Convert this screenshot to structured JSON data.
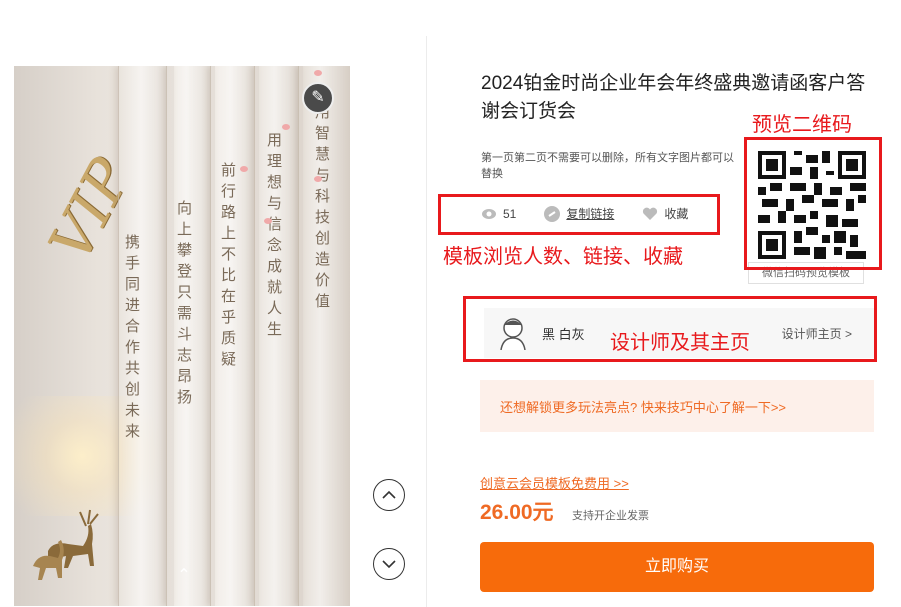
{
  "preview": {
    "vip_text": "VIP",
    "columns": [
      "携手同进合作共创未来",
      "向上攀登只需斗志昂扬",
      "前行路上不比在乎质疑",
      "用理想与信念成就人生",
      "用智慧与科技创造价值"
    ]
  },
  "product": {
    "title": "2024铂金时尚企业年会年终盛典邀请函客户答谢会订货会",
    "description": "第一页第二页不需要可以删除，所有文字图片都可以替换",
    "views": "51",
    "copy_link_label": "复制链接",
    "favorite_label": "收藏",
    "qr_caption": "微信扫码预览模板"
  },
  "designer": {
    "name": "黑 白灰",
    "homepage_label": "设计师主页 >"
  },
  "tip_text": "还想解锁更多玩法亮点? 快来技巧中心了解一下>>",
  "vip_offer": "创意云会员模板免费用 >>",
  "price": "26.00元",
  "invoice_note": "支持开企业发票",
  "buy_label": "立即购买",
  "annotations": {
    "qr": "预览二维码",
    "stats": "模板浏览人数、链接、收藏",
    "designer": "设计师及其主页"
  },
  "colors": {
    "accent": "#f76b0b",
    "annotation": "#e8191c"
  }
}
